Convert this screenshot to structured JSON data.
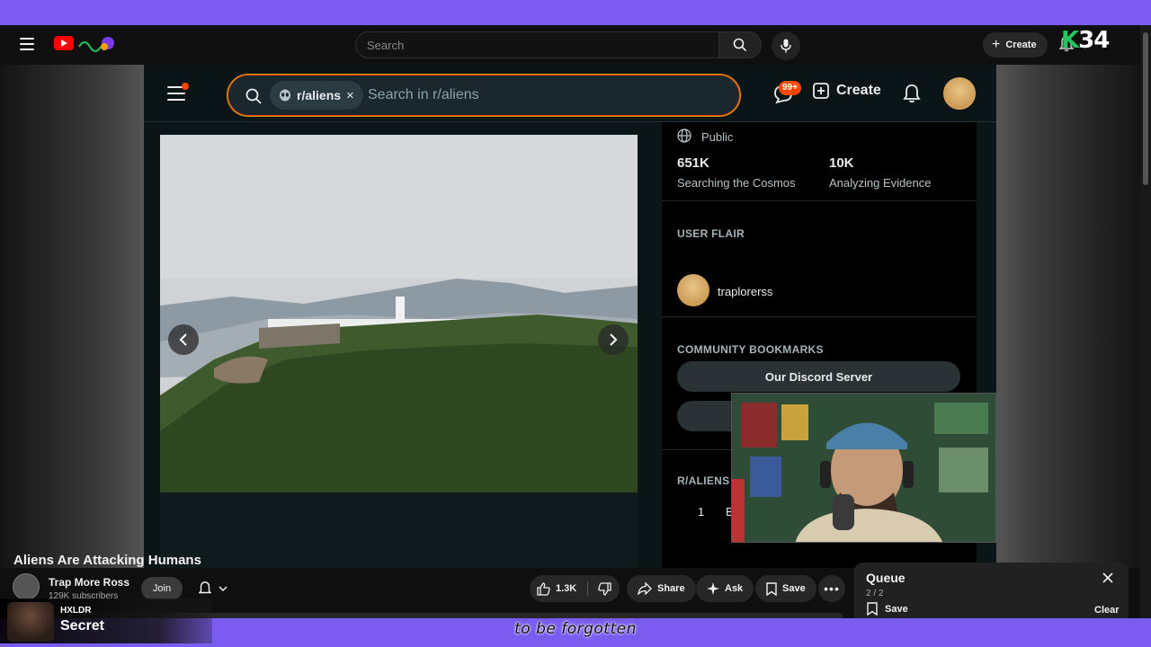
{
  "youtube": {
    "search_placeholder": "Search",
    "create_label": "Create",
    "video_title": "Aliens Are Attacking Humans",
    "channel_name": "Trap More Ross",
    "subscribers": "129K subscribers",
    "join_label": "Join",
    "likes": "1.3K",
    "share_label": "Share",
    "ask_label": "Ask",
    "save_label": "Save",
    "queue": {
      "title": "Queue",
      "count": "2 / 2",
      "save_label": "Save",
      "clear_label": "Clear"
    }
  },
  "overlay": {
    "counter": "34",
    "counter_prefix": "K",
    "caption": "to be forgotten",
    "alert_user": "HXLDR",
    "alert_message": "Secret"
  },
  "reddit": {
    "search_chip": "r/aliens",
    "search_placeholder": "Search in r/aliens",
    "notif_badge": "99+",
    "create_label": "Create",
    "visibility": "Public",
    "stats": [
      {
        "value": "651K",
        "label": "Searching the Cosmos"
      },
      {
        "value": "10K",
        "label": "Analyzing Evidence"
      }
    ],
    "user_flair_heading": "USER FLAIR",
    "username": "traplorerss",
    "bookmarks_heading": "COMMUNITY BOOKMARKS",
    "bookmark_1": "Our Discord Server",
    "rules_heading": "R/ALIENS",
    "rule_number": "1",
    "rule_letter": "B"
  },
  "colors": {
    "frame": "#7b5cf0",
    "youtube_bg": "#0f0f0f",
    "reddit_orange": "#ff4500",
    "search_outline": "#d4a017"
  }
}
